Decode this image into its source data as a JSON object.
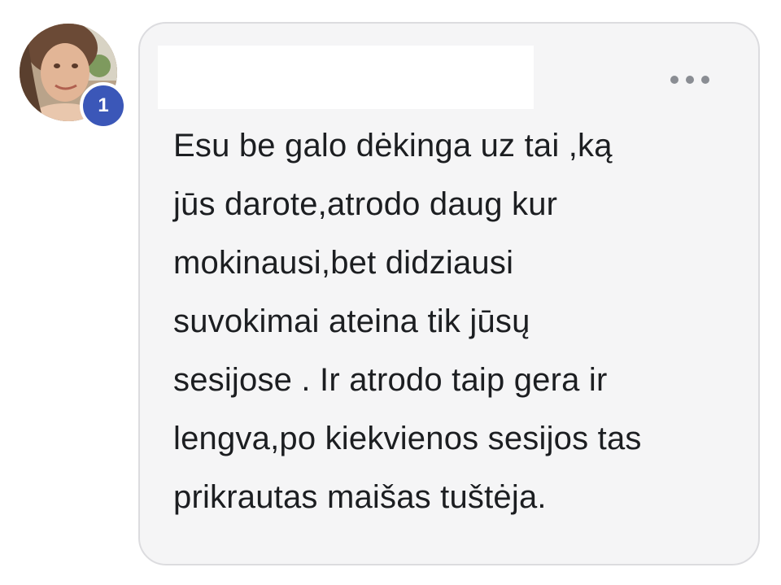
{
  "comment": {
    "author_avatar": "avatar",
    "badge_count": "1",
    "more_options_icon": "more-horizontal-icon",
    "text": "Esu be galo dėkinga uz tai ,ką\njūs darote,atrodo daug kur\nmokinausi,bet didziausi\nsuvokimai ateina tik jūsų\nsesijose . Ir atrodo taip gera ir\nlengva,po kiekvienos sesijos tas\nprikrautas maišas tuštėja."
  },
  "colors": {
    "badge": "#3b57b8",
    "bubble_bg": "#f5f5f6",
    "bubble_border": "#dcdcdf",
    "text": "#1c1e21",
    "icon": "#8a8d93"
  }
}
